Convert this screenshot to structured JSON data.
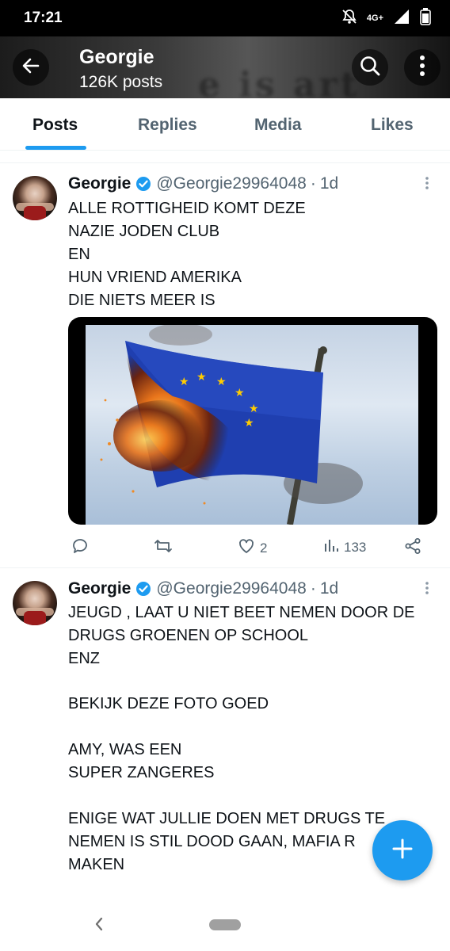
{
  "status_bar": {
    "time": "17:21",
    "network": "4G+",
    "icons": [
      "notifications-off-icon",
      "signal-icon",
      "battery-icon"
    ]
  },
  "profile_header": {
    "name": "Georgie",
    "posts_count": "126K posts",
    "banner_text": "e is art",
    "icons": [
      "back-arrow-icon",
      "search-icon",
      "more-vertical-icon"
    ]
  },
  "tabs": [
    {
      "label": "Posts",
      "active": true
    },
    {
      "label": "Replies",
      "active": false
    },
    {
      "label": "Media",
      "active": false
    },
    {
      "label": "Likes",
      "active": false
    }
  ],
  "tweets": [
    {
      "author": "Georgie",
      "handle": "@Georgie29964048",
      "time": "1d",
      "verified": true,
      "lines": [
        "ALLE ROTTIGHEID KOMT DEZE",
        "NAZIE JODEN CLUB",
        "EN",
        "HUN VRIEND AMERIKA",
        "DIE NIETS MEER IS"
      ],
      "media": "burning-eu-flag-image",
      "stats": {
        "replies": "",
        "reposts": "",
        "likes": "2",
        "views": "133"
      }
    },
    {
      "author": "Georgie",
      "handle": "@Georgie29964048",
      "time": "1d",
      "verified": true,
      "lines": [
        "JEUGD , LAAT U NIET BEET NEMEN DOOR DE",
        "DRUGS GROENEN OP SCHOOL",
        "ENZ",
        "",
        "BEKIJK DEZE FOTO GOED",
        "",
        "AMY, WAS EEN",
        "SUPER ZANGERES",
        "",
        "ENIGE WAT JULLIE DOEN MET DRUGS TE",
        "NEMEN IS STIL DOOD GAAN,  MAFIA R",
        "MAKEN"
      ]
    }
  ],
  "colors": {
    "accent": "#1d9bf0",
    "text_primary": "#0f1419",
    "text_secondary": "#536471",
    "verified": "#1d9bf0"
  },
  "fab": {
    "icon": "plus-icon"
  },
  "nav_bar": {
    "icons": [
      "nav-back-icon",
      "home-pill"
    ]
  }
}
